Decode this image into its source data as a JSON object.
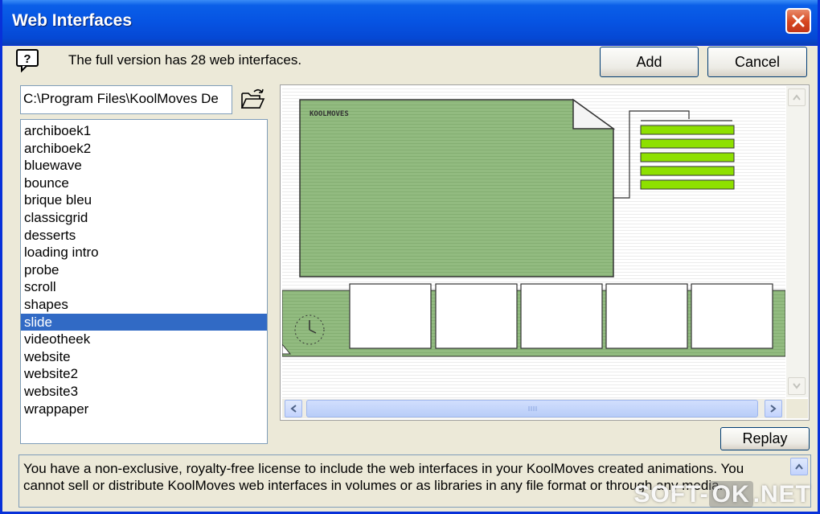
{
  "window": {
    "title": "Web Interfaces"
  },
  "info": {
    "text": "The full version has 28 web interfaces."
  },
  "buttons": {
    "add": "Add",
    "cancel": "Cancel",
    "replay": "Replay"
  },
  "path": {
    "value": "C:\\Program Files\\KoolMoves De"
  },
  "interfaces": {
    "items": [
      "archiboek1",
      "archiboek2",
      "bluewave",
      "bounce",
      "brique bleu",
      "classicgrid",
      "desserts",
      "loading intro",
      "probe",
      "scroll",
      "shapes",
      "slide",
      "videotheek",
      "website",
      "website2",
      "website3",
      "wrappaper"
    ],
    "selected": "slide"
  },
  "preview": {
    "logo_text": "KOOLMOVES",
    "accent_green": "#8ee000",
    "panel_green": "#8fba7e"
  },
  "license": {
    "text": "You have a non-exclusive, royalty-free license to include the web interfaces in your KoolMoves created animations. You cannot sell or distribute KoolMoves web interfaces in volumes or as libraries in any file format or through any media."
  },
  "watermark": {
    "left": "SOFT-",
    "middle": "OK",
    "right": ".NET"
  },
  "icons": [
    "help-icon",
    "close-icon",
    "folder-open-icon",
    "clock-icon",
    "scroll-up-icon",
    "scroll-down-icon",
    "scroll-left-icon",
    "scroll-right-icon"
  ]
}
